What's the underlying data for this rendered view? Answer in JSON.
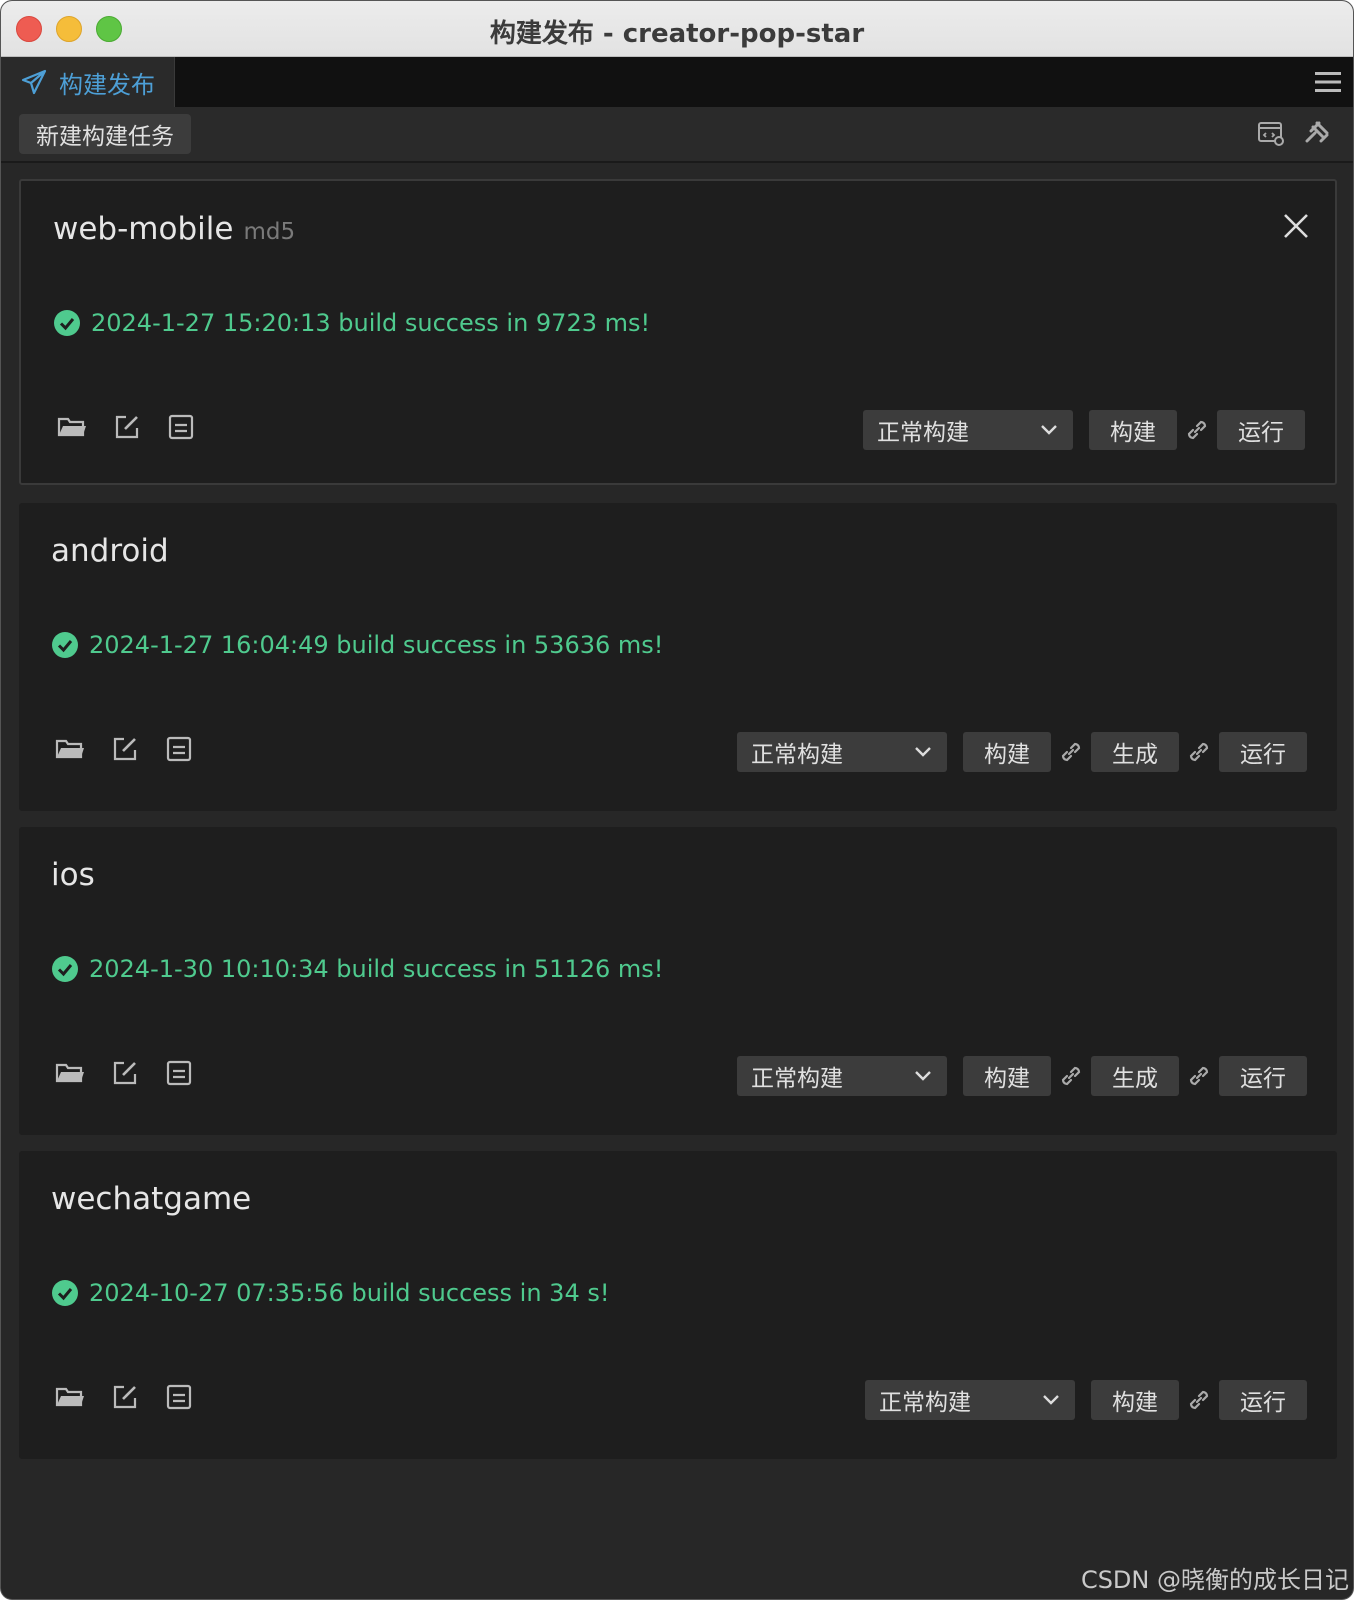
{
  "window": {
    "title": "构建发布 - creator-pop-star"
  },
  "tab": {
    "label": "构建发布",
    "icon": "paper-plane-icon"
  },
  "toolbar": {
    "new_task_label": "新建构建任务"
  },
  "colors": {
    "accent": "#4d9fd6",
    "success": "#4fca8e",
    "panel": "#1e1e1e",
    "button": "#3c3c3c"
  },
  "cards": [
    {
      "name": "web-mobile",
      "tag": "md5",
      "status": "2024-1-27 15:20:13 build success in 9723 ms!",
      "mode": "正常构建",
      "buttons": {
        "build": "构建",
        "make": "",
        "run": "运行"
      }
    },
    {
      "name": "android",
      "tag": "",
      "status": "2024-1-27 16:04:49 build success in 53636 ms!",
      "mode": "正常构建",
      "buttons": {
        "build": "构建",
        "make": "生成",
        "run": "运行"
      }
    },
    {
      "name": "ios",
      "tag": "",
      "status": "2024-1-30 10:10:34 build success in 51126 ms!",
      "mode": "正常构建",
      "buttons": {
        "build": "构建",
        "make": "生成",
        "run": "运行"
      }
    },
    {
      "name": "wechatgame",
      "tag": "",
      "status": "2024-10-27 07:35:56 build success in 34 s!",
      "mode": "正常构建",
      "buttons": {
        "build": "构建",
        "make": "",
        "run": "运行"
      }
    }
  ],
  "watermark": "CSDN @晓衡的成长日记"
}
